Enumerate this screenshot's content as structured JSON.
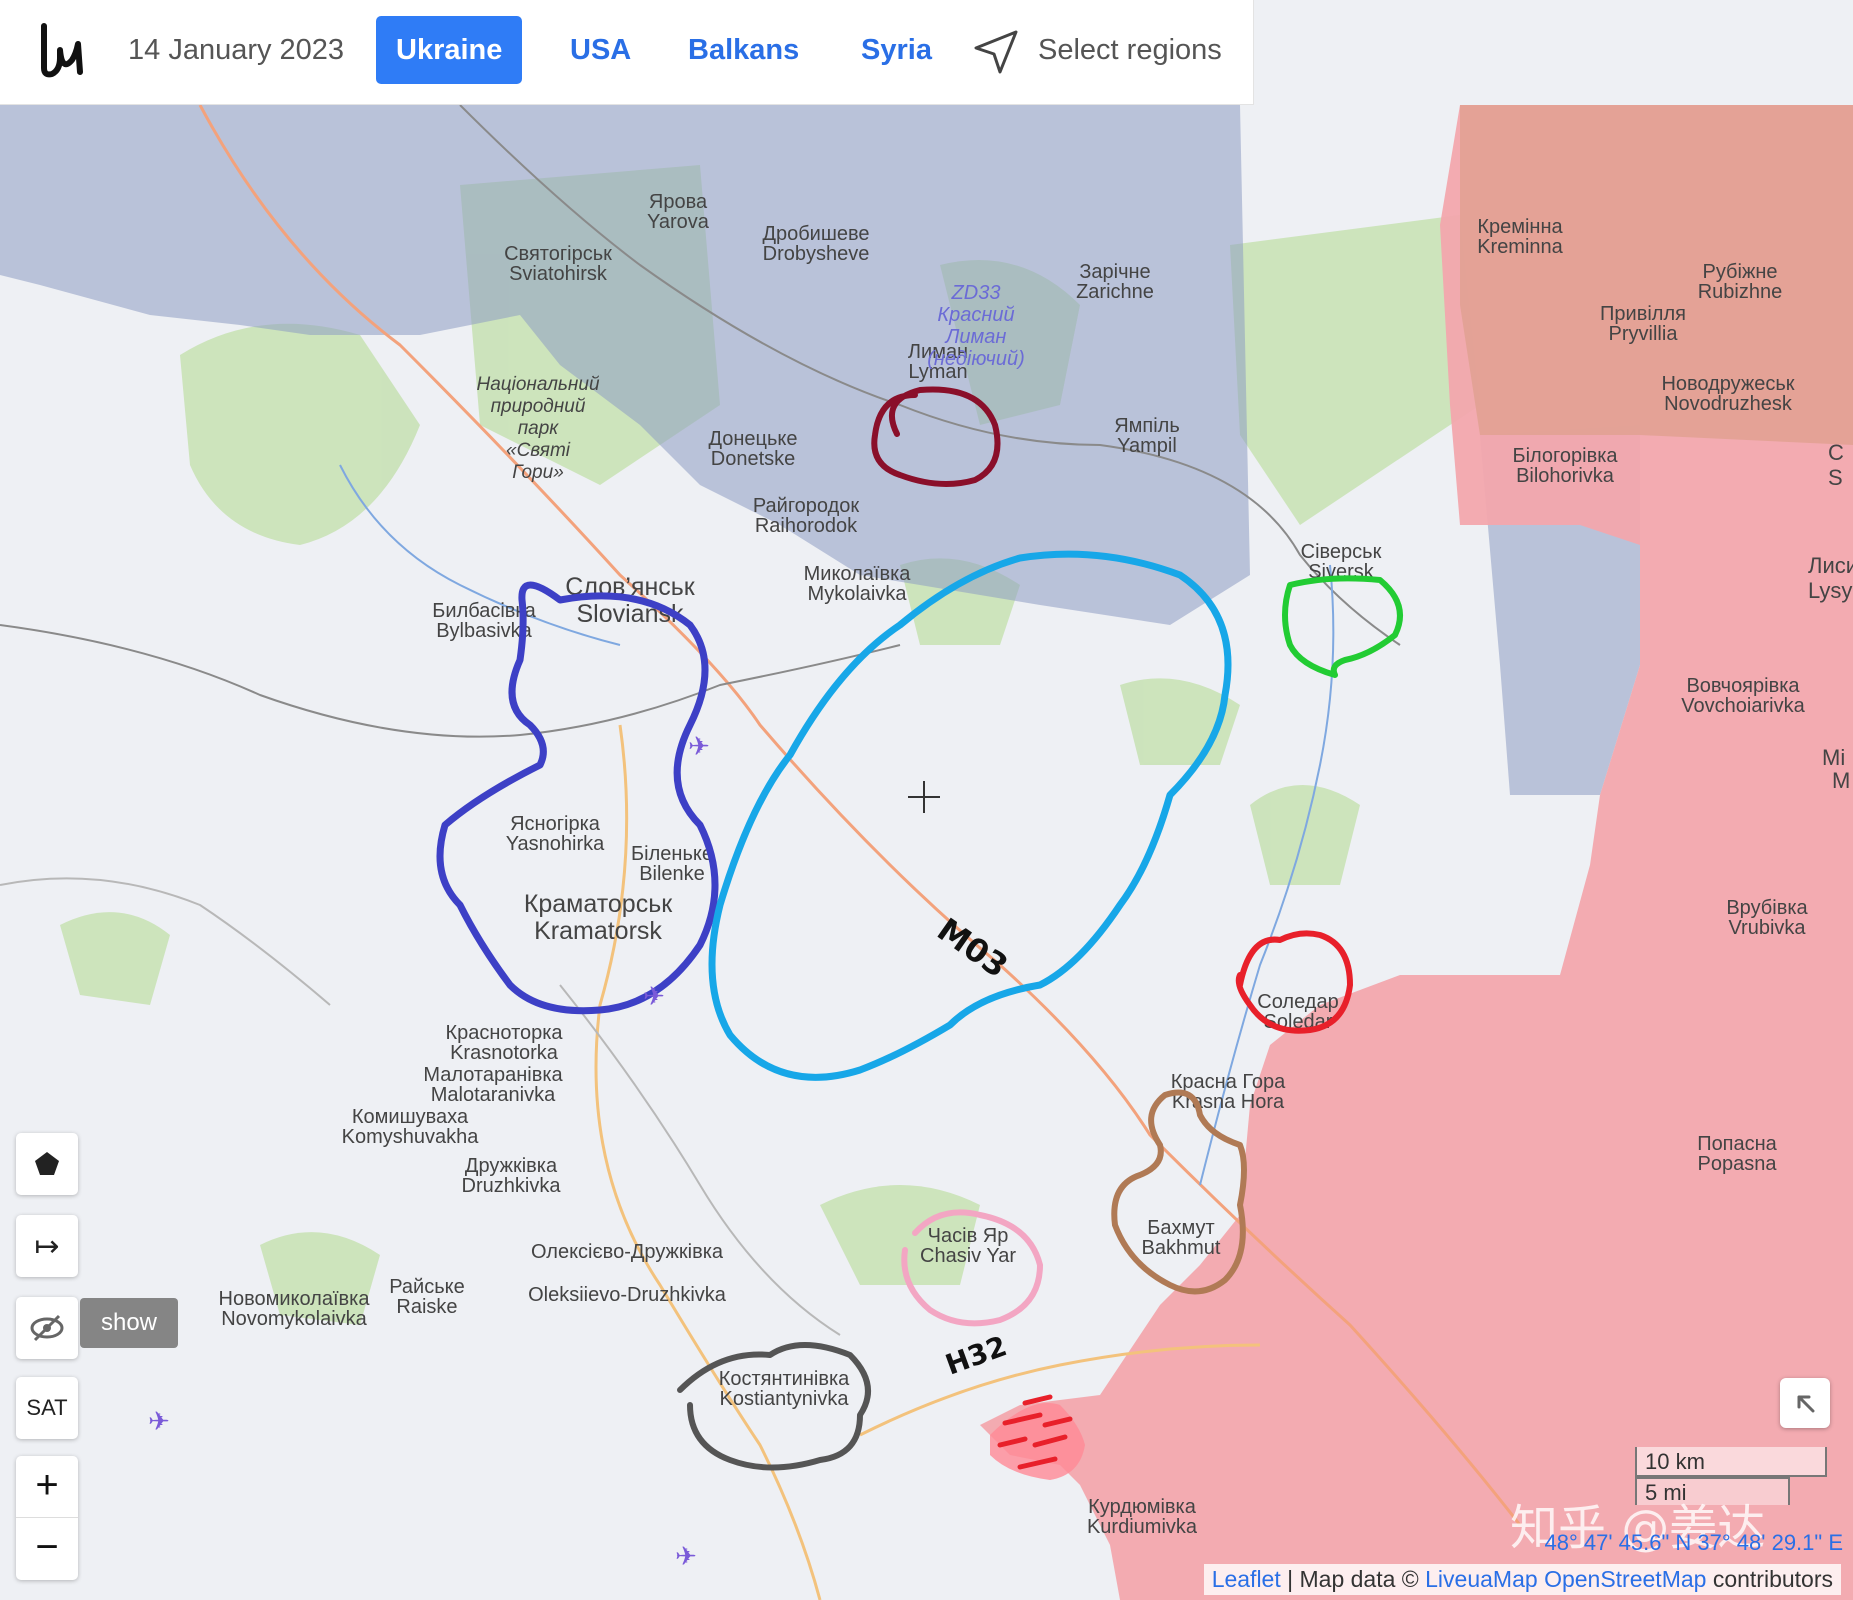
{
  "header": {
    "date": "14 January 2023",
    "tabs": [
      {
        "label": "Ukraine",
        "active": true
      },
      {
        "label": "USA",
        "active": false
      },
      {
        "label": "Balkans",
        "active": false
      },
      {
        "label": "Syria",
        "active": false
      }
    ],
    "select_regions": "Select regions"
  },
  "map": {
    "places": [
      {
        "uk": "Ярова",
        "en": "Yarova"
      },
      {
        "uk": "Святогірськ",
        "en": "Sviatohirsk"
      },
      {
        "uk": "Дробишеве",
        "en": "Drobysheve"
      },
      {
        "uk": "Зарічне",
        "en": "Zarichne"
      },
      {
        "uk": "Кремінна",
        "en": "Kreminna"
      },
      {
        "uk": "Рубіжне",
        "en": "Rubizhne"
      },
      {
        "uk": "Привілля",
        "en": "Pryvillia"
      },
      {
        "uk": "Новодружеськ",
        "en": "Novodruzhesk"
      },
      {
        "uk": "Лиман",
        "en": "Lyman"
      },
      {
        "uk": "Ямпіль",
        "en": "Yampil"
      },
      {
        "uk": "Донецьке",
        "en": "Donetske"
      },
      {
        "uk": "Білогорівка",
        "en": "Bilohorivka"
      },
      {
        "uk": "Райгородок",
        "en": "Raihorodok"
      },
      {
        "uk": "Сіверськ",
        "en": "Siversk"
      },
      {
        "uk": "Миколаївка",
        "en": "Mykolaivka"
      },
      {
        "uk": "Слов’янськ",
        "en": "Sloviansk"
      },
      {
        "uk": "Билбасівка",
        "en": "Bylbasivka"
      },
      {
        "uk": "Вовчоярівка",
        "en": "Vovchoiarivka"
      },
      {
        "uk": "Ясногірка",
        "en": "Yasnohirka"
      },
      {
        "uk": "Біленьке",
        "en": "Bilenke"
      },
      {
        "uk": "Краматорськ",
        "en": "Kramatorsk"
      },
      {
        "uk": "Врубівка",
        "en": "Vrubivka"
      },
      {
        "uk": "Соледар",
        "en": "Soledar"
      },
      {
        "uk": "Красноторка",
        "en": "Krasnotorka"
      },
      {
        "uk": "Малотаранівка",
        "en": "Malotaranivka"
      },
      {
        "uk": "Красна Гора",
        "en": "Krasna Hora"
      },
      {
        "uk": "Комишуваха",
        "en": "Komyshuvakha"
      },
      {
        "uk": "Попасна",
        "en": "Popasna"
      },
      {
        "uk": "Дружківка",
        "en": "Druzhkivka"
      },
      {
        "uk": "Бахмут",
        "en": "Bakhmut"
      },
      {
        "uk": "Часів Яр",
        "en": "Chasiv Yar"
      },
      {
        "uk": "Олексієво-Дружківка",
        "en": "Oleksiievo-Druzhkivka"
      },
      {
        "uk": "Новомиколаївка",
        "en": "Novomykolaivka"
      },
      {
        "uk": "Райське",
        "en": "Raiske"
      },
      {
        "uk": "Костянтинівка",
        "en": "Kostiantynivka"
      },
      {
        "uk": "Курдюмівка",
        "en": "Kurdiumivka"
      }
    ],
    "park_label": [
      "Національний",
      "природний",
      "парк",
      "«Святі",
      "Гори»"
    ],
    "zd33_label": [
      "ZD33",
      "Красний",
      "Лиман",
      "(недiючий)"
    ],
    "edge_labels": [
      "С",
      "S",
      "Лисич",
      "Lysyc",
      "Mi",
      "M"
    ],
    "road_labels": [
      "M03",
      "H32"
    ]
  },
  "controls": {
    "show_label": "show",
    "sat_label": "SAT",
    "zoom_in": "+",
    "zoom_out": "−",
    "measure_symbol": "↦"
  },
  "footer": {
    "scale_km": "10 km",
    "scale_mi": "5 mi",
    "coords": "48° 47' 45.6\" N 37° 48' 29.1\" E",
    "attribution_leaflet": "Leaflet",
    "attribution_sep": " | Map data © ",
    "attribution_livemap": "LiveuaMap",
    "attribution_osm": "OpenStreetMap",
    "attribution_contributors": " contributors",
    "watermark": "知乎 @姜达"
  },
  "colors": {
    "occupied": "#f2a7ad",
    "occupied_dark": "#e0a090",
    "contested": "#8e9dc2",
    "tab_active": "#2f7cf6",
    "link": "#2a6fe6",
    "circle_sloviansk": "#3d40c6",
    "circle_m03": "#17a7e8",
    "circle_lyman": "#8a0f2a",
    "circle_siversk": "#22cc33",
    "circle_soledar": "#e8202a",
    "circle_bakhmut": "#b07a55",
    "circle_chasiv": "#f3a6c3",
    "circle_kostiantynivka": "#555555"
  }
}
